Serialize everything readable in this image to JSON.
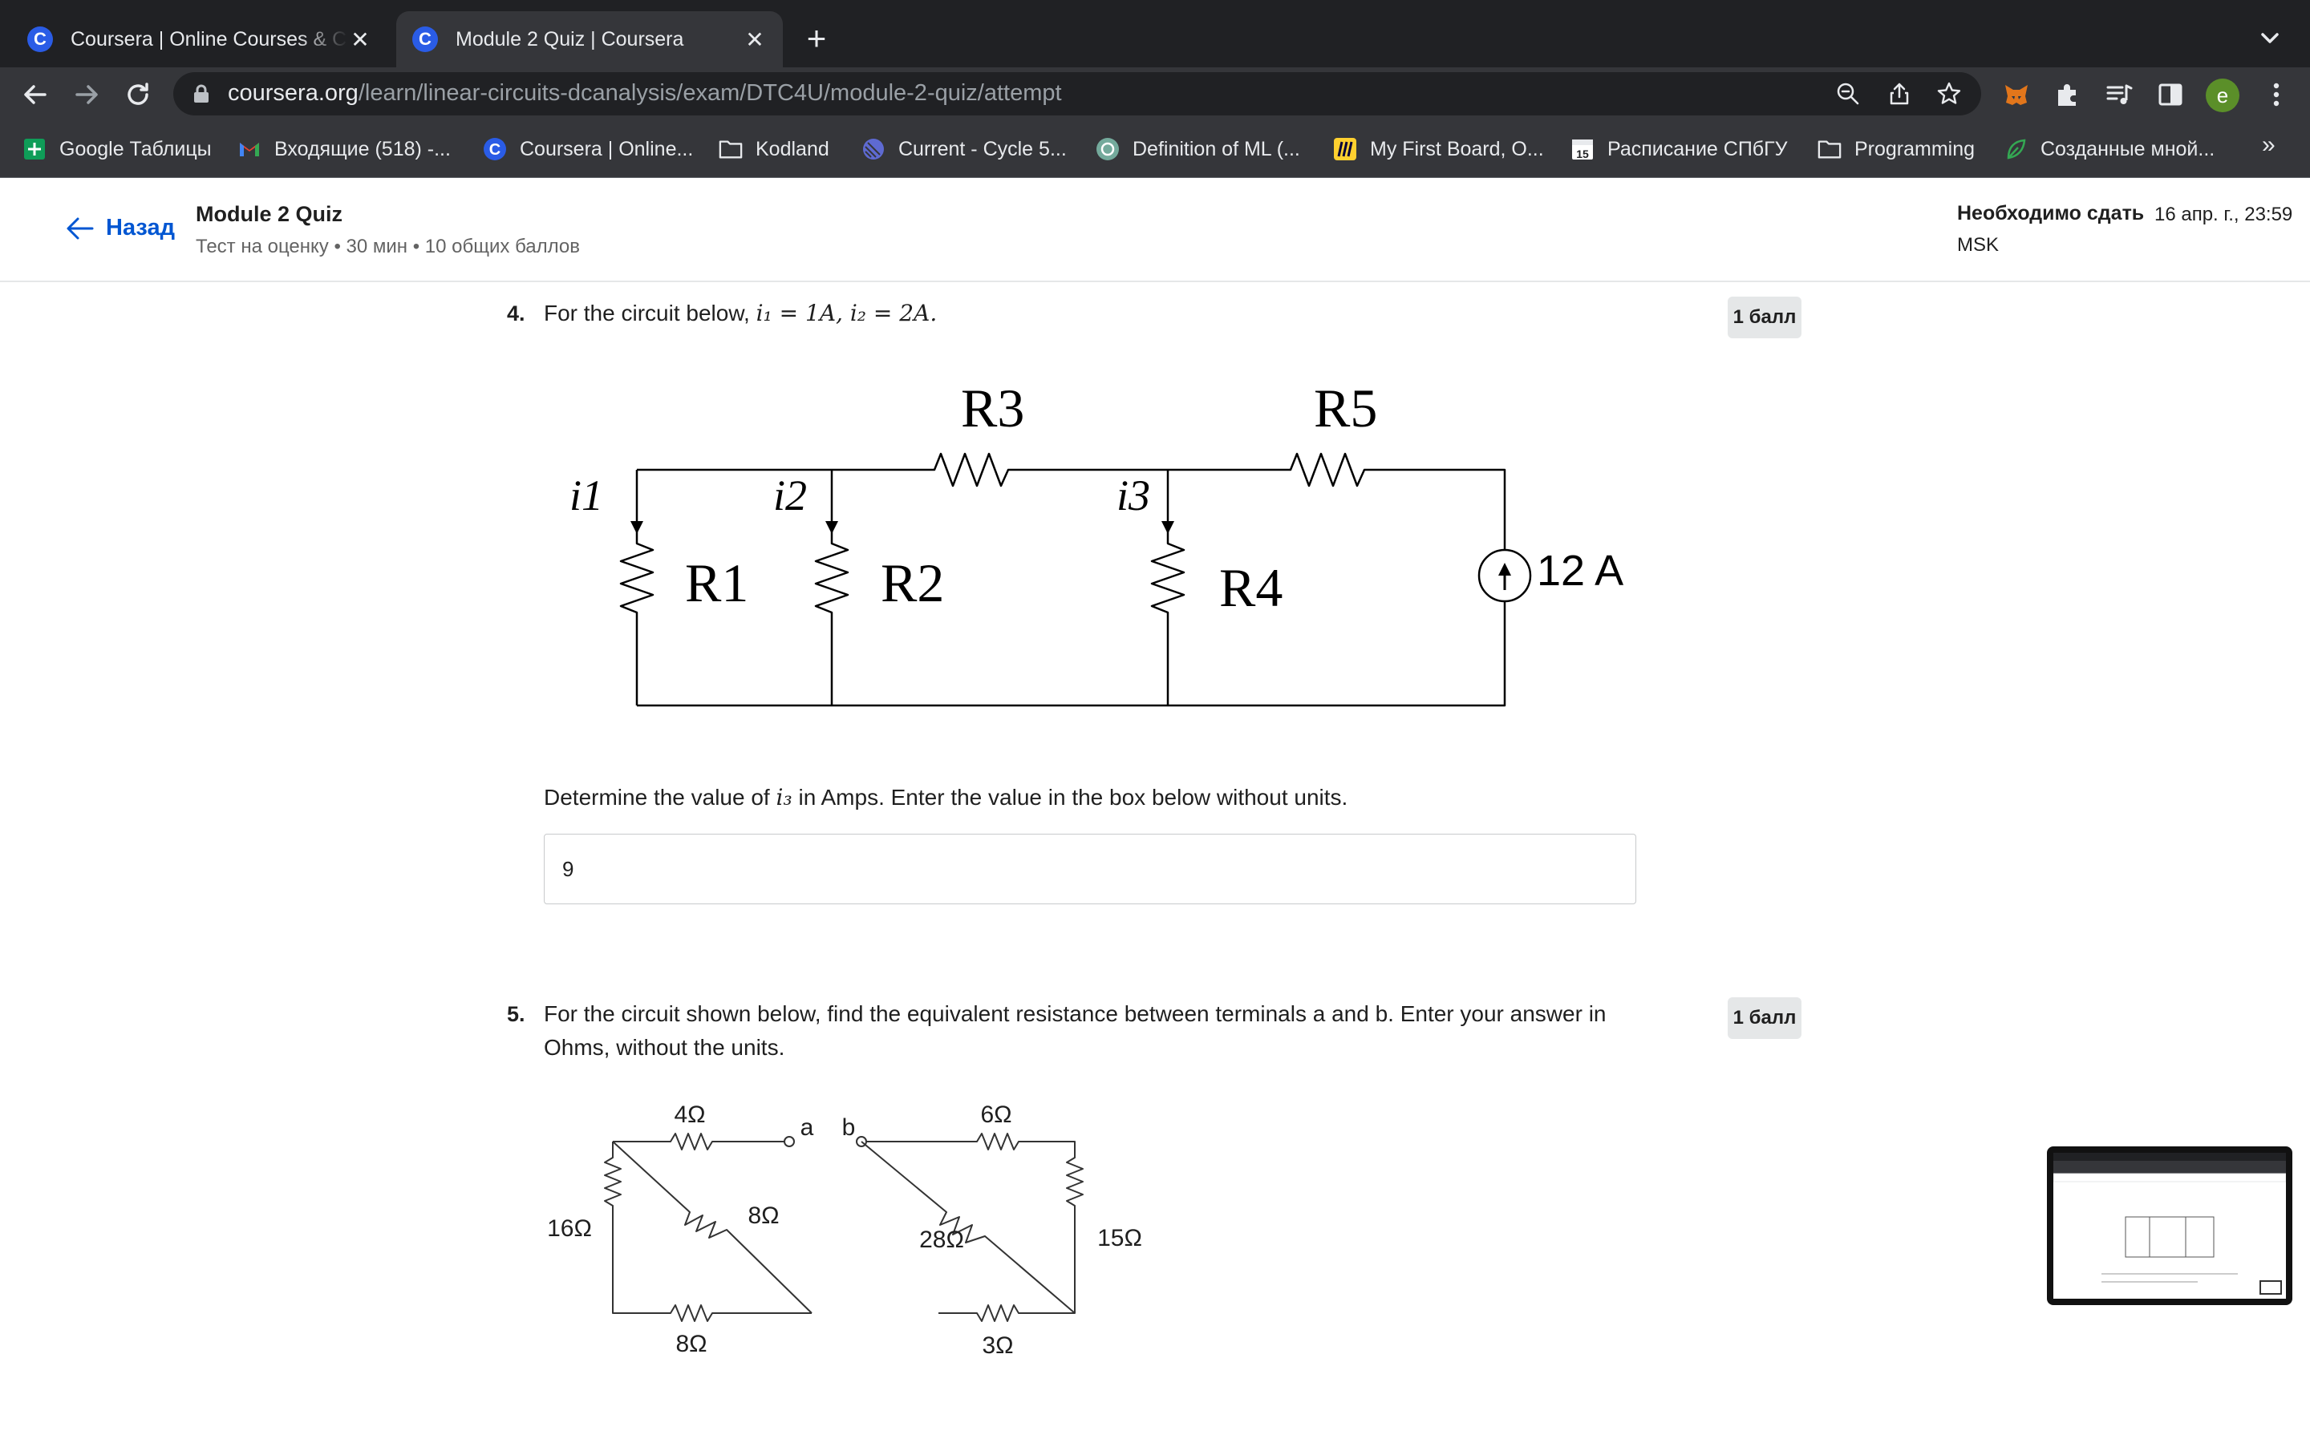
{
  "browser": {
    "tabs": [
      {
        "title": "Coursera | Online Courses & Credentials",
        "favicon": "C"
      },
      {
        "title": "Module 2 Quiz | Coursera",
        "favicon": "C"
      }
    ],
    "new_tab": "+",
    "url_host": "coursera.org",
    "url_path": "/learn/linear-circuits-dcanalysis/exam/DTC4U/module-2-quiz/attempt",
    "profile_initial": "e",
    "bookmarks": [
      {
        "label": "Google Таблицы",
        "icon": "sheets-icon"
      },
      {
        "label": "Входящие (518) -...",
        "icon": "gmail-icon"
      },
      {
        "label": "Coursera | Online...",
        "icon": "coursera-icon"
      },
      {
        "label": "Kodland",
        "icon": "folder-icon"
      },
      {
        "label": "Current - Cycle 5...",
        "icon": "linear-icon"
      },
      {
        "label": "Definition of ML (...",
        "icon": "openai-icon"
      },
      {
        "label": "My First Board, O...",
        "icon": "miro-icon"
      },
      {
        "label": "Расписание СПбГУ",
        "icon": "calendar-icon"
      },
      {
        "label": "Programming",
        "icon": "folder-icon"
      },
      {
        "label": "Созданные мной...",
        "icon": "leaf-icon"
      }
    ],
    "bookmarks_more": "»",
    "calendar_day": "15"
  },
  "header": {
    "back_label": "Назад",
    "quiz_title": "Module 2 Quiz",
    "quiz_meta": "Тест на оценку • 30 мин • 10 общих баллов",
    "due_label": "Необходимо сдать",
    "due_date": "16 апр. г., 23:59",
    "due_tz": "MSK"
  },
  "questions": [
    {
      "number": "4.",
      "prompt_prefix": "For the circuit below, ",
      "prompt_math": "i₁ = 1A, i₂ = 2A.",
      "points": "1 балл",
      "circuit": {
        "resistors": [
          "R1",
          "R2",
          "R3",
          "R4",
          "R5"
        ],
        "currents": [
          "i1",
          "i2",
          "i3"
        ],
        "source": "12 A"
      },
      "instruction_prefix": "Determine the value of ",
      "instruction_math": "i₃",
      "instruction_suffix": " in Amps. Enter the value in the box below without units.",
      "answer": "9"
    },
    {
      "number": "5.",
      "prompt": "For the circuit shown below, find the equivalent resistance between terminals a and b. Enter your answer in Ohms, without the units.",
      "points": "1 балл",
      "circuit": {
        "labels": [
          "4Ω",
          "a",
          "b",
          "6Ω",
          "16Ω",
          "8Ω",
          "28Ω",
          "15Ω",
          "8Ω",
          "3Ω"
        ]
      }
    }
  ]
}
